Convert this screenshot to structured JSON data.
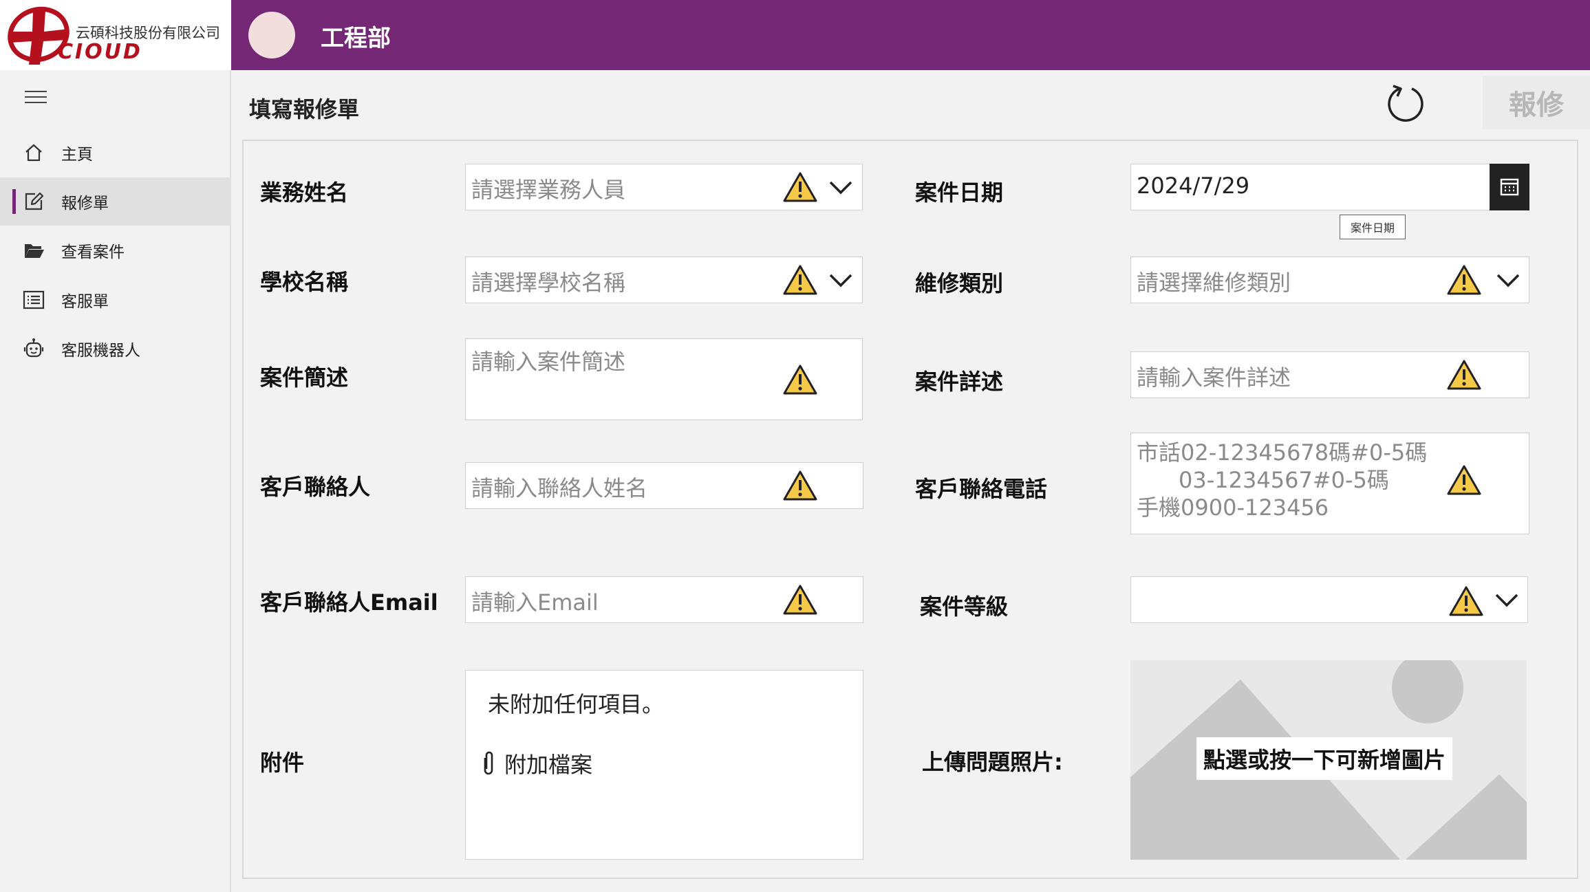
{
  "brand": {
    "company": "云碩科技股份有限公司",
    "wordmark": "CIOUD",
    "primary_color": "#742774",
    "logo_red": "#b5101e"
  },
  "header": {
    "title": "工程部"
  },
  "sidebar": {
    "items": [
      {
        "label": "主頁",
        "icon": "home-icon"
      },
      {
        "label": "報修單",
        "icon": "edit-icon",
        "active": true
      },
      {
        "label": "查看案件",
        "icon": "folder-open-icon"
      },
      {
        "label": "客服單",
        "icon": "list-icon"
      },
      {
        "label": "客服機器人",
        "icon": "bot-icon"
      }
    ]
  },
  "page": {
    "title": "填寫報修單",
    "submit_label": "報修"
  },
  "form": {
    "salesperson": {
      "label": "業務姓名",
      "placeholder": "請選擇業務人員"
    },
    "school": {
      "label": "學校名稱",
      "placeholder": "請選擇學校名稱"
    },
    "summary": {
      "label": "案件簡述",
      "placeholder": "請輸入案件簡述"
    },
    "contact": {
      "label": "客戶聯絡人",
      "placeholder": "請輸入聯絡人姓名"
    },
    "email": {
      "label": "客戶聯絡人Email",
      "placeholder": "請輸入Email"
    },
    "attachments": {
      "label": "附件",
      "empty_text": "未附加任何項目。",
      "add_label": "附加檔案"
    },
    "case_date": {
      "label": "案件日期",
      "value": "2024/7/29",
      "tooltip": "案件日期"
    },
    "repair_type": {
      "label": "維修類別",
      "placeholder": "請選擇維修類別"
    },
    "detail": {
      "label": "案件詳述",
      "placeholder": "請輸入案件詳述"
    },
    "phone": {
      "label": "客戶聯絡電話",
      "placeholder_lines": [
        "市話02-12345678碼#0-5碼",
        "      03-1234567#0-5碼",
        "手機0900-123456"
      ]
    },
    "level": {
      "label": "案件等級",
      "value": ""
    },
    "photo": {
      "label": "上傳問題照片:",
      "hint": "點選或按一下可新增圖片"
    }
  }
}
